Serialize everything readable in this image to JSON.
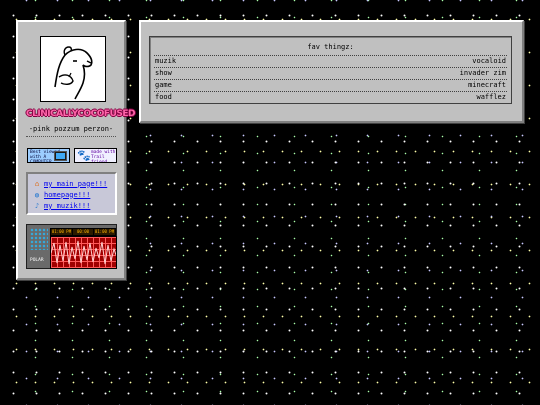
{
  "sidebar": {
    "site_logo_text": "CLINICALLYCOCOFUSED",
    "tagline": "-pink pozzum perzon-",
    "buttons": {
      "computer": "Best viewed with A COMPUTER",
      "dog": "made with Trail friend"
    },
    "links": [
      {
        "label": "my main page!!!",
        "icon": "home-icon"
      },
      {
        "label": "homepage!!!",
        "icon": "globe-icon"
      },
      {
        "label": "my muzik!!!",
        "icon": "music-icon"
      }
    ],
    "device": {
      "lcd_1": "01:00 PM",
      "lcd_2": "00:00",
      "lcd_3": "01:00 PM",
      "label": "POLAR"
    }
  },
  "favs": {
    "title": "fav thingz:",
    "rows": [
      {
        "key": "muzik",
        "value": "vocaloid"
      },
      {
        "key": "show",
        "value": "invader zim"
      },
      {
        "key": "game",
        "value": "minecraft"
      },
      {
        "key": "food",
        "value": "wafflez"
      }
    ]
  },
  "colors": {
    "background": "#000000",
    "panel": "#c0c0c0",
    "link": "#0000ee",
    "logo": "#ff66aa"
  }
}
